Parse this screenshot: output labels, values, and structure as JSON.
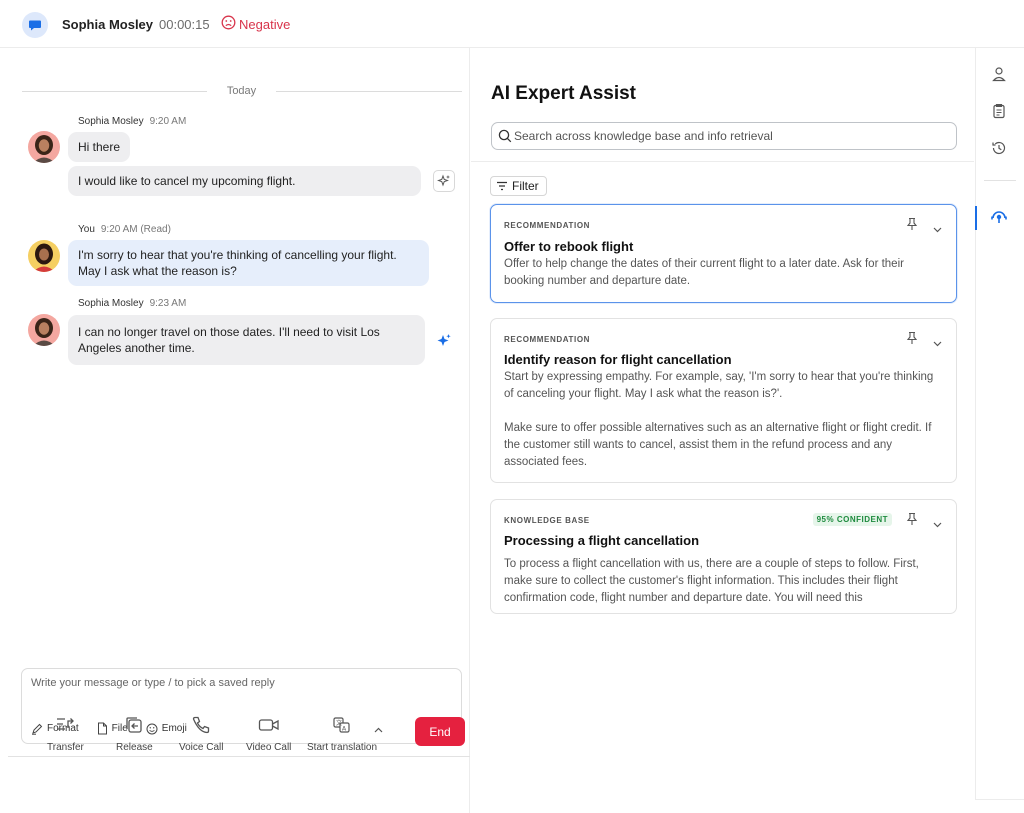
{
  "header": {
    "contact_name": "Sophia Mosley",
    "timer": "00:00:15",
    "sentiment": "Negative",
    "sentiment_color": "#d8344b",
    "chat_icon": "chat-bubble-icon",
    "sentiment_icon": "sad-face-icon"
  },
  "chat": {
    "day_label": "Today",
    "messages": [
      {
        "sender": "Sophia Mosley",
        "time": "9:20 AM",
        "text": "Hi there"
      },
      {
        "text": "I would like to cancel my upcoming flight."
      },
      {
        "sender": "You",
        "time": "9:20 AM (Read)",
        "text": "I'm sorry to hear that you're thinking of cancelling your flight. May I ask what the reason is?"
      },
      {
        "sender": "Sophia Mosley",
        "time": "9:23 AM",
        "text": "I can no longer travel on those dates. I'll need to visit Los Angeles another time."
      }
    ],
    "composer": {
      "placeholder": "Write your message or type / to pick a saved reply",
      "format_label": "Format",
      "file_label": "File",
      "emoji_label": "Emoji"
    },
    "actions": {
      "transfer": "Transfer",
      "release": "Release",
      "voice_call": "Voice Call",
      "video_call": "Video Call",
      "start_translation": "Start translation",
      "end": "End"
    },
    "end_color": "#e5213f"
  },
  "assist": {
    "title": "AI Expert Assist",
    "search_placeholder": "Search across knowledge base and info retrieval",
    "filter_label": "Filter",
    "cards": [
      {
        "tag": "RECOMMENDATION",
        "title": "Offer to rebook flight",
        "body": "Offer to help change the dates of their current flight to a later date. Ask for their booking number and departure date."
      },
      {
        "tag": "RECOMMENDATION",
        "title": "Identify reason for flight cancellation",
        "body_p1": "Start by expressing empathy. For example, say, 'I'm sorry to hear that you're thinking of canceling your flight. May I ask what the reason is?'.",
        "body_p2": "Make sure to offer possible alternatives such as an alternative flight or flight credit. If the customer still wants to cancel, assist them in the refund process and any associated fees."
      },
      {
        "tag": "KNOWLEDGE BASE",
        "confidence": "95% CONFIDENT",
        "title": "Processing a flight cancellation",
        "body": "To process a flight cancellation with us, there are a couple of steps to follow. First, make sure to collect the customer's flight information. This includes their flight confirmation code, flight number and departure date. You will need this"
      }
    ],
    "accent_color": "#1a6ee6"
  },
  "rail": {
    "icons": [
      "user-icon",
      "clipboard-icon",
      "history-icon",
      "ai-assist-icon"
    ]
  }
}
